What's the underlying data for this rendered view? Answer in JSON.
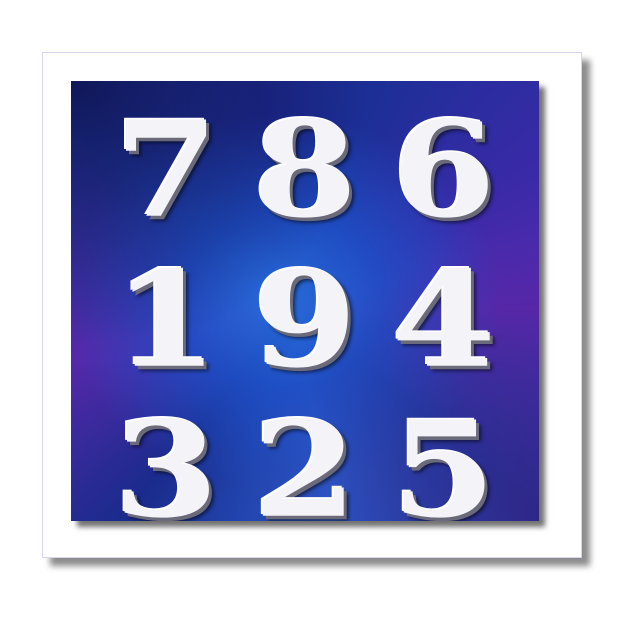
{
  "icon": {
    "digits": [
      [
        "7",
        "8",
        "6"
      ],
      [
        "1",
        "9",
        "4"
      ],
      [
        "3",
        "2",
        "5"
      ]
    ],
    "colors": {
      "frame": "#ffffff",
      "panel_primary": "#2440b0",
      "panel_accent": "#5a28ac",
      "digit": "#f4f4f8"
    }
  }
}
